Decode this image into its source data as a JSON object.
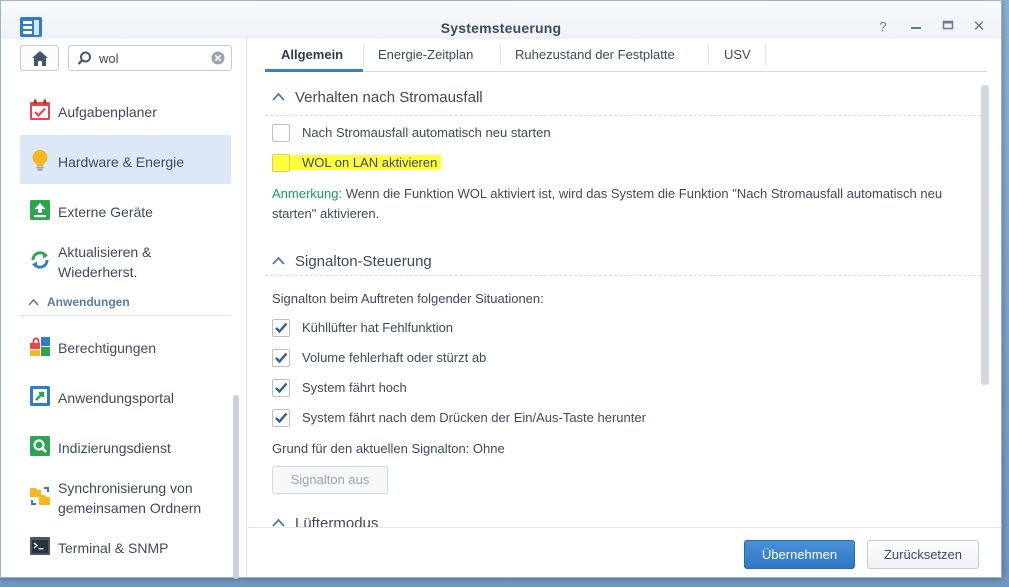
{
  "window": {
    "title": "Systemsteuerung",
    "controls": {
      "help": "?",
      "close": "✕"
    }
  },
  "sidebar": {
    "search": {
      "value": "wol",
      "placeholder": ""
    },
    "items_top": [
      {
        "label": "Aufgabenplaner",
        "icon": "calendar-check-icon"
      },
      {
        "label": "Hardware & Energie",
        "icon": "lightbulb-icon",
        "active": true
      },
      {
        "label": "Externe Geräte",
        "icon": "external-device-icon"
      },
      {
        "label": "Aktualisieren & Wiederherst.",
        "icon": "refresh-icon"
      }
    ],
    "section_label": "Anwendungen",
    "items_apps": [
      {
        "label": "Berechtigungen",
        "icon": "permissions-icon"
      },
      {
        "label": "Anwendungsportal",
        "icon": "app-portal-icon"
      },
      {
        "label": "Indizierungsdienst",
        "icon": "index-search-icon"
      },
      {
        "label": "Synchronisierung von gemeinsamen Ordnern",
        "icon": "shared-folder-sync-icon"
      },
      {
        "label": "Terminal & SNMP",
        "icon": "terminal-icon"
      }
    ]
  },
  "tabs": [
    {
      "label": "Allgemein",
      "active": true
    },
    {
      "label": "Energie-Zeitplan"
    },
    {
      "label": "Ruhezustand der Festplatte"
    },
    {
      "label": "USV"
    }
  ],
  "content": {
    "section_power": {
      "title": "Verhalten nach Stromausfall",
      "options": [
        {
          "label": "Nach Stromausfall automatisch neu starten",
          "checked": false
        },
        {
          "label": "WOL on LAN aktivieren",
          "checked": false,
          "highlighted": true
        }
      ],
      "note_label": "Anmerkung:",
      "note_text": " Wenn die Funktion WOL aktiviert ist, wird das System die Funktion \"Nach Stromausfall automatisch neu starten\" aktivieren."
    },
    "section_beep": {
      "title": "Signalton-Steuerung",
      "intro": "Signalton beim Auftreten folgender Situationen:",
      "options": [
        {
          "label": "Kühllüfter hat Fehlfunktion",
          "checked": true
        },
        {
          "label": "Volume fehlerhaft oder stürzt ab",
          "checked": true
        },
        {
          "label": "System fährt hoch",
          "checked": true
        },
        {
          "label": "System fährt nach dem Drücken der Ein/Aus-Taste herunter",
          "checked": true
        }
      ],
      "reason": "Grund für den aktuellen Signalton: Ohne",
      "button": "Signalton aus"
    },
    "section_fan": {
      "title": "Lüftermodus"
    }
  },
  "footer": {
    "apply": "Übernehmen",
    "reset": "Zurücksetzen"
  },
  "colors": {
    "accent": "#3b7fc4",
    "highlight": "#ffff3c",
    "note_label": "#1b9a64",
    "active_nav": "#dce8f5"
  }
}
